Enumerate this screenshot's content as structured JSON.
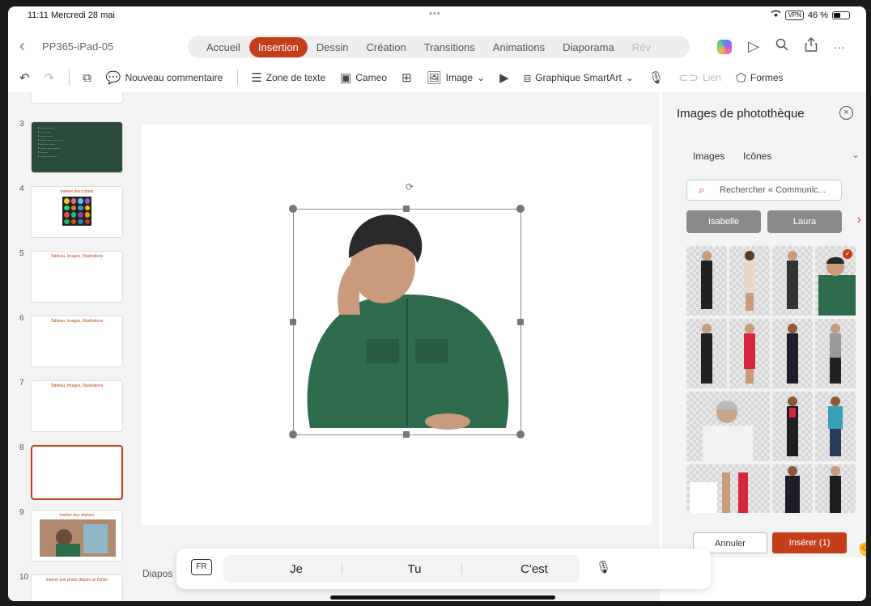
{
  "status": {
    "time": "11:11",
    "date": "Mercredi 28 mai",
    "vpn": "VPN",
    "battery": "46 %"
  },
  "document": {
    "title": "PP365-iPad-05"
  },
  "tabs": [
    {
      "label": "Accueil",
      "active": false
    },
    {
      "label": "Insertion",
      "active": true
    },
    {
      "label": "Dessin",
      "active": false
    },
    {
      "label": "Création",
      "active": false
    },
    {
      "label": "Transitions",
      "active": false
    },
    {
      "label": "Animations",
      "active": false
    },
    {
      "label": "Diaporama",
      "active": false
    },
    {
      "label": "Rév",
      "active": false
    }
  ],
  "ribbon": {
    "comment": "Nouveau commentaire",
    "textbox": "Zone de texte",
    "cameo": "Cameo",
    "image": "Image",
    "smartart": "Graphique SmartArt",
    "link": "Lien",
    "shapes": "Formes"
  },
  "slides": [
    {
      "num": "3",
      "title": ""
    },
    {
      "num": "4",
      "title": "Insérer des icônes"
    },
    {
      "num": "5",
      "title": "Tableau, Images, Illustrations"
    },
    {
      "num": "6",
      "title": "Tableau, Images, Illustrations"
    },
    {
      "num": "7",
      "title": "Tableau, Images, Illustrations"
    },
    {
      "num": "8",
      "title": ""
    },
    {
      "num": "9",
      "title": "Insérer des stickers"
    },
    {
      "num": "10",
      "title": "Insérer une photo depuis un fichier"
    }
  ],
  "panel": {
    "title": "Images de photothèque",
    "tab_images": "Images",
    "tab_icons": "Icônes",
    "search_placeholder": "Rechercher « Communic...",
    "chip1": "Isabelle",
    "chip2": "Laura",
    "cancel": "Annuler",
    "insert": "Insérer (1)"
  },
  "keyboard": {
    "lang": "FR",
    "suggestions": [
      "Je",
      "Tu",
      "C'est"
    ]
  },
  "canvas": {
    "notes_label": "Diapos"
  },
  "colors": {
    "accent": "#c43e1c",
    "shirt": "#2f6b4d"
  }
}
